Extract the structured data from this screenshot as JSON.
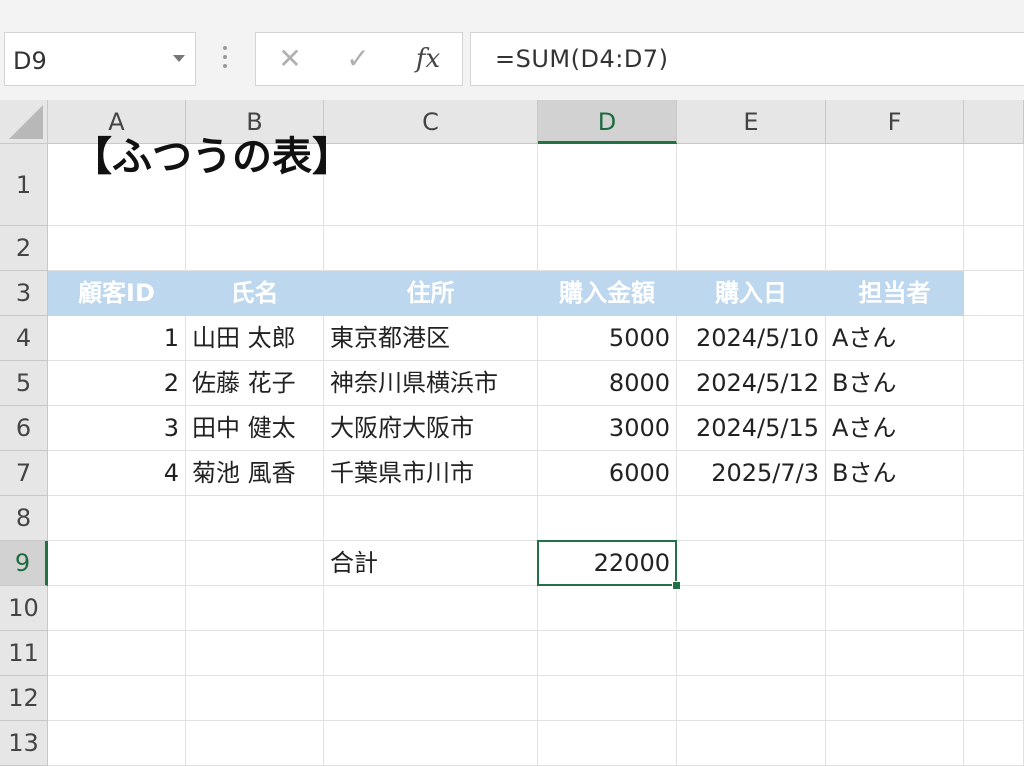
{
  "formula_bar": {
    "name_box": "D9",
    "cancel_glyph": "✕",
    "enter_glyph": "✓",
    "fx_label": "fx",
    "formula": "=SUM(D4:D7)"
  },
  "columns": [
    "A",
    "B",
    "C",
    "D",
    "E",
    "F"
  ],
  "active_column": "D",
  "rows": [
    "1",
    "2",
    "3",
    "4",
    "5",
    "6",
    "7",
    "8",
    "9",
    "10",
    "11",
    "12",
    "13"
  ],
  "active_row": "9",
  "sheet": {
    "title": "【ふつうの表】",
    "headers": [
      "顧客ID",
      "氏名",
      "住所",
      "購入金額",
      "購入日",
      "担当者"
    ],
    "records": [
      [
        "1",
        "山田 太郎",
        "東京都港区",
        "5000",
        "2024/5/10",
        "Aさん"
      ],
      [
        "2",
        "佐藤 花子",
        "神奈川県横浜市",
        "8000",
        "2024/5/12",
        "Bさん"
      ],
      [
        "3",
        "田中 健太",
        "大阪府大阪市",
        "3000",
        "2024/5/15",
        "Aさん"
      ],
      [
        "4",
        "菊池 風香",
        "千葉県市川市",
        "6000",
        "2025/7/3",
        "Bさん"
      ]
    ],
    "total_label": "合計",
    "total_value": "22000"
  },
  "colors": {
    "header_fill": "#bdd7ee",
    "selection": "#217346"
  }
}
